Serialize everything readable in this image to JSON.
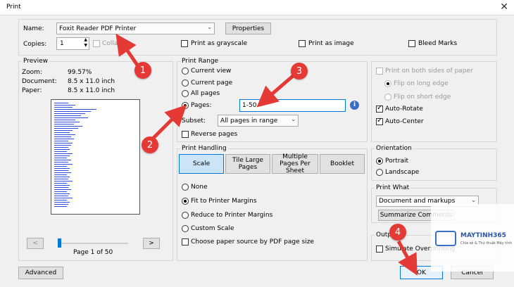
{
  "window": {
    "title": "Print",
    "close_glyph": "✕"
  },
  "printer": {
    "name_label": "Name:",
    "name_value": "Foxit Reader PDF Printer",
    "properties_label": "Properties",
    "copies_label": "Copies:",
    "copies_value": "1",
    "collate_label": "Collate",
    "grayscale_label": "Print as grayscale",
    "image_label": "Print as image",
    "bleed_label": "Bleed Marks"
  },
  "preview": {
    "title": "Preview",
    "zoom_label": "Zoom:",
    "zoom_value": "99.57%",
    "document_label": "Document:",
    "document_value": "8.5 x 11.0 inch",
    "paper_label": "Paper:",
    "paper_value": "8.5 x 11.0 inch",
    "prev_glyph": "<",
    "next_glyph": ">",
    "page_status": "Page 1 of 50"
  },
  "range": {
    "title": "Print Range",
    "current_view": "Current view",
    "current_page": "Current page",
    "all_pages": "All pages",
    "pages_label": "Pages:",
    "pages_value": "1-50",
    "subset_label": "Subset:",
    "subset_value": "All pages in range",
    "reverse_label": "Reverse pages"
  },
  "handling": {
    "title": "Print Handling",
    "tabs": [
      {
        "label": "Scale",
        "active": true
      },
      {
        "label": "Tile Large Pages",
        "active": false
      },
      {
        "label": "Multiple Pages Per Sheet",
        "active": false
      },
      {
        "label": "Booklet",
        "active": false
      }
    ],
    "none": "None",
    "fit": "Fit to Printer Margins",
    "reduce": "Reduce to Printer Margins",
    "custom": "Custom Scale",
    "paper_source": "Choose paper source by PDF page size"
  },
  "duplex": {
    "both_sides": "Print on both sides of paper",
    "long_edge": "Flip on long edge",
    "short_edge": "Flip on short edge",
    "auto_rotate": "Auto-Rotate",
    "auto_center": "Auto-Center"
  },
  "orientation": {
    "title": "Orientation",
    "portrait": "Portrait",
    "landscape": "Landscape"
  },
  "print_what": {
    "title": "Print What",
    "value": "Document and markups",
    "summarize_label": "Summarize Comments"
  },
  "output": {
    "title": "Output",
    "simulate_label": "Simulate Overprinting"
  },
  "footer": {
    "advanced_label": "Advanced",
    "ok_label": "OK",
    "cancel_label": "Cancel"
  },
  "annotations": {
    "m1": "1",
    "m2": "2",
    "m3": "3",
    "m4": "4"
  },
  "watermark": {
    "brand": "MAYTINH365",
    "tagline": "Chia sẻ & Thủ thuật Máy tính"
  },
  "colors": {
    "marker": "#e53935",
    "accent": "#0078d7",
    "preview_text": "#2d4bd8"
  }
}
